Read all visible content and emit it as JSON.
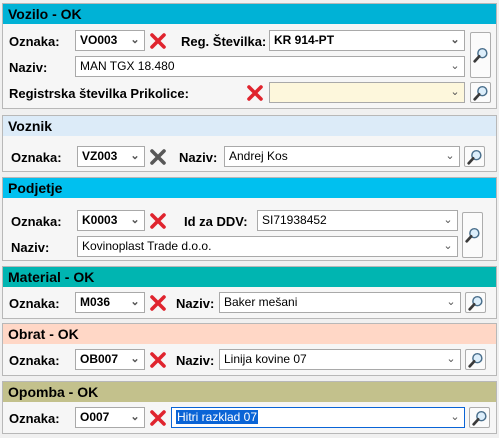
{
  "colors": {
    "vozilo": "#00b2d6",
    "voznik": "#dcebf8",
    "podjetje": "#00c0ef",
    "material": "#00b5b1",
    "obrat": "#ffd7c6",
    "opomba": "#c3c18c"
  },
  "vozilo": {
    "title": "Vozilo - OK",
    "oznaka_label": "Oznaka:",
    "oznaka_value": "VO003",
    "reg_label": "Reg. Številka:",
    "reg_value": "KR 914-PT",
    "naziv_label": "Naziv:",
    "naziv_value": "MAN TGX 18.480",
    "prikolica_label": "Registrska številka Prikolice:",
    "prikolica_value": ""
  },
  "voznik": {
    "title": "Voznik",
    "oznaka_label": "Oznaka:",
    "oznaka_value": "VZ003",
    "naziv_label": "Naziv:",
    "naziv_value": "Andrej Kos"
  },
  "podjetje": {
    "title": "Podjetje",
    "oznaka_label": "Oznaka:",
    "oznaka_value": "K0003",
    "ddv_label": "Id za DDV:",
    "ddv_value": "SI71938452",
    "naziv_label": "Naziv:",
    "naziv_value": "Kovinoplast Trade d.o.o."
  },
  "material": {
    "title": "Material - OK",
    "oznaka_label": "Oznaka:",
    "oznaka_value": "M036",
    "naziv_label": "Naziv:",
    "naziv_value": "Baker mešani"
  },
  "obrat": {
    "title": "Obrat - OK",
    "oznaka_label": "Oznaka:",
    "oznaka_value": "OB007",
    "naziv_label": "Naziv:",
    "naziv_value": "Linija kovine 07"
  },
  "opomba": {
    "title": "Opomba - OK",
    "oznaka_label": "Oznaka:",
    "oznaka_value": "O007",
    "text_value": "Hitri razklad 07"
  }
}
